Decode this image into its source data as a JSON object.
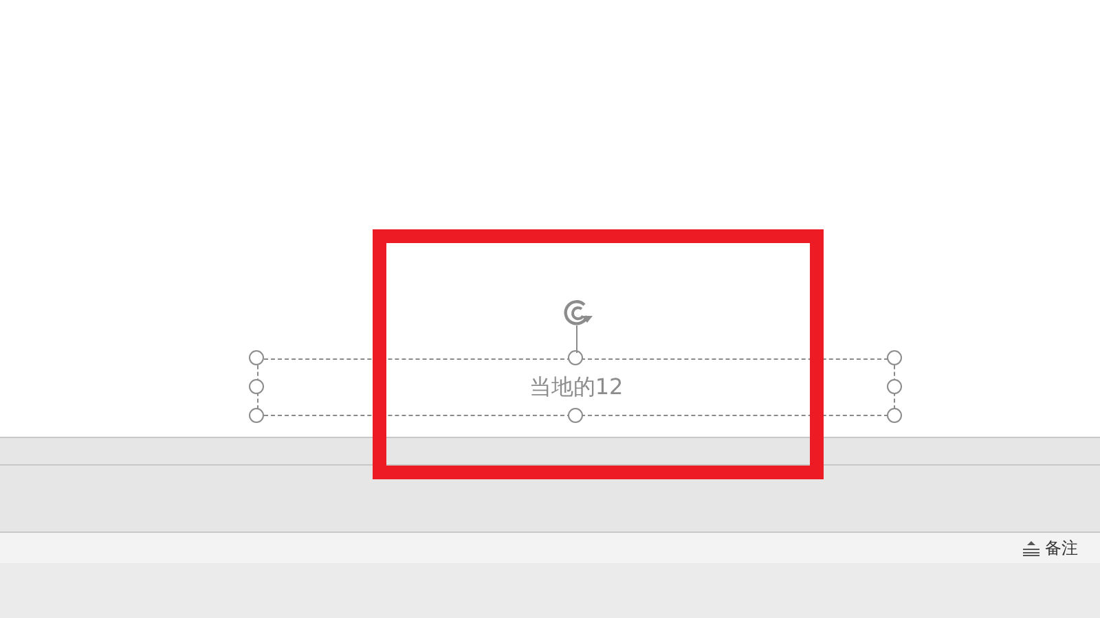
{
  "slide": {
    "text_box": {
      "text": "当地的12",
      "selected": true
    }
  },
  "status_bar": {
    "notes_button": "备注"
  }
}
